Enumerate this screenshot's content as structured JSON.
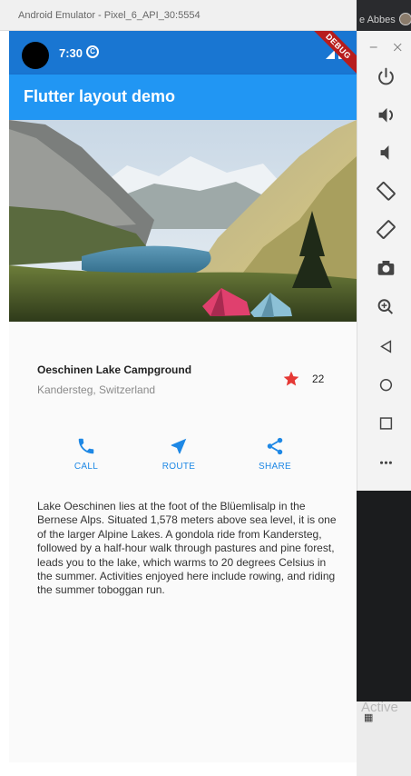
{
  "desktop": {
    "user_text": "e Abbes",
    "activate_text": "Active"
  },
  "emulator": {
    "title": "Android Emulator - Pixel_6_API_30:5554",
    "window_controls": [
      "minimize-icon",
      "close-icon"
    ],
    "side_toolbar": [
      "power-icon",
      "volume-up-icon",
      "volume-down-icon",
      "rotate-left-icon",
      "rotate-right-icon",
      "camera-icon",
      "zoom-icon",
      "back-icon",
      "home-icon",
      "overview-icon",
      "more-icon"
    ]
  },
  "status_bar": {
    "time": "7:30",
    "color": "#1976d2"
  },
  "debug_banner": "DEBUG",
  "app_bar": {
    "title": "Flutter layout demo",
    "color": "#2196f3"
  },
  "title_section": {
    "name": "Oeschinen Lake Campground",
    "location": "Kandersteg, Switzerland",
    "star_count": "22",
    "star_color": "#e53935"
  },
  "buttons": [
    {
      "label": "CALL",
      "icon": "phone-icon"
    },
    {
      "label": "ROUTE",
      "icon": "near-me-icon"
    },
    {
      "label": "SHARE",
      "icon": "share-icon"
    }
  ],
  "accent_color": "#1e88e5",
  "description": "Lake Oeschinen lies at the foot of the Blüemlisalp in the Bernese Alps. Situated 1,578 meters above sea level, it is one of the larger Alpine Lakes. A gondola ride from Kandersteg, followed by a half-hour walk through pastures and pine forest, leads you to the lake, which warms to 20 degrees Celsius in the summer. Activities enjoyed here include rowing, and riding the summer toboggan run."
}
